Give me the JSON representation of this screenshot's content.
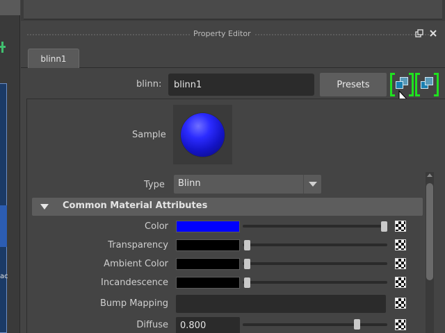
{
  "window": {
    "title": "Property Editor",
    "float_icon": "float-window-icon",
    "close_icon": "close-icon"
  },
  "tabs": [
    {
      "label": "blinn1"
    }
  ],
  "header": {
    "node_type_label": "blinn:",
    "node_name": "blinn1",
    "presets_label": "Presets",
    "show_input_icon": "show-input-connections-icon",
    "show_output_icon": "show-output-connections-icon"
  },
  "sample": {
    "label": "Sample",
    "color": "#2b2bff"
  },
  "type": {
    "label": "Type",
    "value": "Blinn"
  },
  "section": {
    "label": "Common Material Attributes",
    "expanded": true
  },
  "attributes": [
    {
      "label": "Color",
      "swatch": "#0000ff",
      "slider": 1.0
    },
    {
      "label": "Transparency",
      "swatch": "#000000",
      "slider": 0.0
    },
    {
      "label": "Ambient Color",
      "swatch": "#000000",
      "slider": 0.0
    },
    {
      "label": "Incandescence",
      "swatch": "#000000",
      "slider": 0.0
    },
    {
      "label": "Bump Mapping",
      "value": ""
    },
    {
      "label": "Diffuse",
      "value": "0.800",
      "slider": 0.8
    }
  ],
  "colors": {
    "accent_green": "#1fe11f",
    "panel_bg": "#444444",
    "field_bg": "#2b2b2b"
  }
}
